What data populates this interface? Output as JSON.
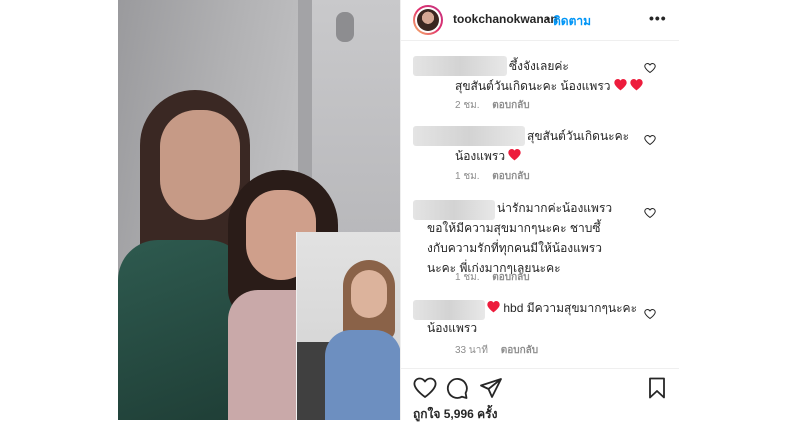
{
  "post": {
    "username": "tookchanokwanan",
    "separator": "•",
    "follow_label": "ติดตาม",
    "more_label": "•••"
  },
  "comments": [
    {
      "lines": [
        "ซึ้งจังเลยค่ะ",
        "สุขสันต์วันเกิดนะคะ น้องแพรว"
      ],
      "hearts": 2,
      "time": "2 ชม.",
      "reply": "ตอบกลับ"
    },
    {
      "lines": [
        "สุขสันต์วันเกิดนะคะ",
        "น้องแพรว"
      ],
      "hearts": 1,
      "time": "1 ชม.",
      "reply": "ตอบกลับ"
    },
    {
      "lines": [
        "น่ารักมากค่ะน้องแพรว",
        "ขอให้มีความสุขมากๆนะคะ ชาบซึ้",
        "งกับความรักที่ทุกคนมีให้น้องแพรว",
        "นะคะ พี่เก่งมากๆเลยนะคะ"
      ],
      "hearts": 0,
      "time": "1 ชม.",
      "reply": "ตอบกลับ"
    },
    {
      "lines": [
        "hbd มีความสุขมากๆนะคะ",
        "น้องแพรว"
      ],
      "hearts": 1,
      "time": "33 นาที",
      "reply": "ตอบกลับ"
    }
  ],
  "footer": {
    "likes": "ถูกใจ 5,996 ครั้ง"
  },
  "icons": {
    "like": "heart-outline-icon",
    "comment": "comment-bubble-icon",
    "share": "paper-plane-icon",
    "save": "bookmark-icon",
    "comment_like": "small-heart-outline-icon",
    "emoji": "red-heart-emoji"
  },
  "colors": {
    "link": "#0095f6",
    "text": "#262626",
    "muted": "#8e8e8e",
    "heart": "#ed1c3c"
  }
}
